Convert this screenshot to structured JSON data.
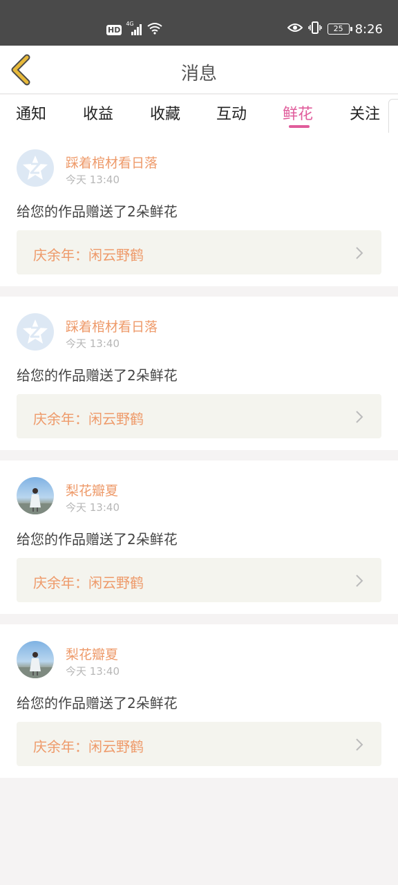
{
  "status_bar": {
    "hd_label": "HD",
    "network_label": "4G",
    "battery": "25",
    "time": "8:26"
  },
  "header": {
    "title": "消息"
  },
  "tabs": [
    {
      "label": "通知",
      "active": false
    },
    {
      "label": "收益",
      "active": false
    },
    {
      "label": "收藏",
      "active": false
    },
    {
      "label": "互动",
      "active": false
    },
    {
      "label": "鲜花",
      "active": true
    },
    {
      "label": "关注",
      "active": false
    }
  ],
  "colors": {
    "accent": "#e05c9b",
    "name_orange": "#ee9a6a",
    "back_arrow": "#e7b93a"
  },
  "items": [
    {
      "user": "踩着棺材看日落",
      "time": "今天 13:40",
      "message": "给您的作品赠送了2朵鲜花",
      "work": "庆余年：闲云野鹤",
      "avatar": "default-avatar-icon"
    },
    {
      "user": "踩着棺材看日落",
      "time": "今天 13:40",
      "message": "给您的作品赠送了2朵鲜花",
      "work": "庆余年：闲云野鹤",
      "avatar": "default-avatar-icon"
    },
    {
      "user": "梨花瓣夏",
      "time": "今天 13:40",
      "message": "给您的作品赠送了2朵鲜花",
      "work": "庆余年：闲云野鹤",
      "avatar": "photo-avatar"
    },
    {
      "user": "梨花瓣夏",
      "time": "今天 13:40",
      "message": "给您的作品赠送了2朵鲜花",
      "work": "庆余年：闲云野鹤",
      "avatar": "photo-avatar"
    }
  ]
}
